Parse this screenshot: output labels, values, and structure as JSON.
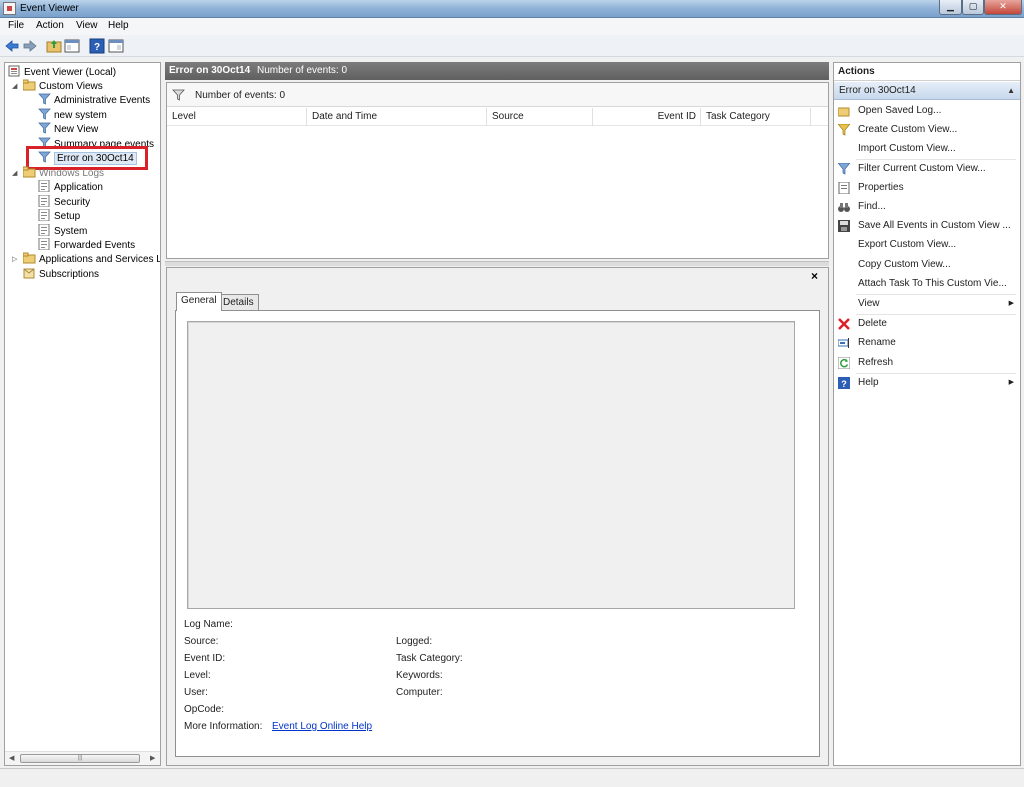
{
  "window": {
    "title": "Event Viewer"
  },
  "menu": [
    "File",
    "Action",
    "View",
    "Help"
  ],
  "tree": {
    "root": "Event Viewer (Local)",
    "custom_views": "Custom Views",
    "custom_items": [
      "Administrative Events",
      "new system",
      "New View",
      "Summary page events",
      "Error on 30Oct14"
    ],
    "windows_logs": "Windows Logs",
    "log_items": [
      "Application",
      "Security",
      "Setup",
      "System",
      "Forwarded Events"
    ],
    "apps_services": "Applications and Services Lo",
    "subscriptions": "Subscriptions"
  },
  "center": {
    "header_title": "Error on 30Oct14",
    "header_count": "Number of events: 0",
    "filter_text": "Number of events: 0",
    "columns": [
      "Level",
      "Date and Time",
      "Source",
      "Event ID",
      "Task Category"
    ],
    "close_glyph": "×",
    "tabs": [
      "General",
      "Details"
    ],
    "fields_left": [
      "Log Name:",
      "Source:",
      "Event ID:",
      "Level:",
      "User:",
      "OpCode:",
      "More Information:"
    ],
    "fields_right": [
      "Logged:",
      "Task Category:",
      "Keywords:",
      "Computer:"
    ],
    "help_link": "Event Log Online Help"
  },
  "actions": {
    "header": "Actions",
    "section": "Error on 30Oct14",
    "items": [
      "Open Saved Log...",
      "Create Custom View...",
      "Import Custom View...",
      "Filter Current Custom View...",
      "Properties",
      "Find...",
      "Save All Events in Custom View ...",
      "Export Custom View...",
      "Copy Custom View...",
      "Attach Task To This Custom Vie...",
      "View",
      "Delete",
      "Rename",
      "Refresh",
      "Help"
    ]
  }
}
